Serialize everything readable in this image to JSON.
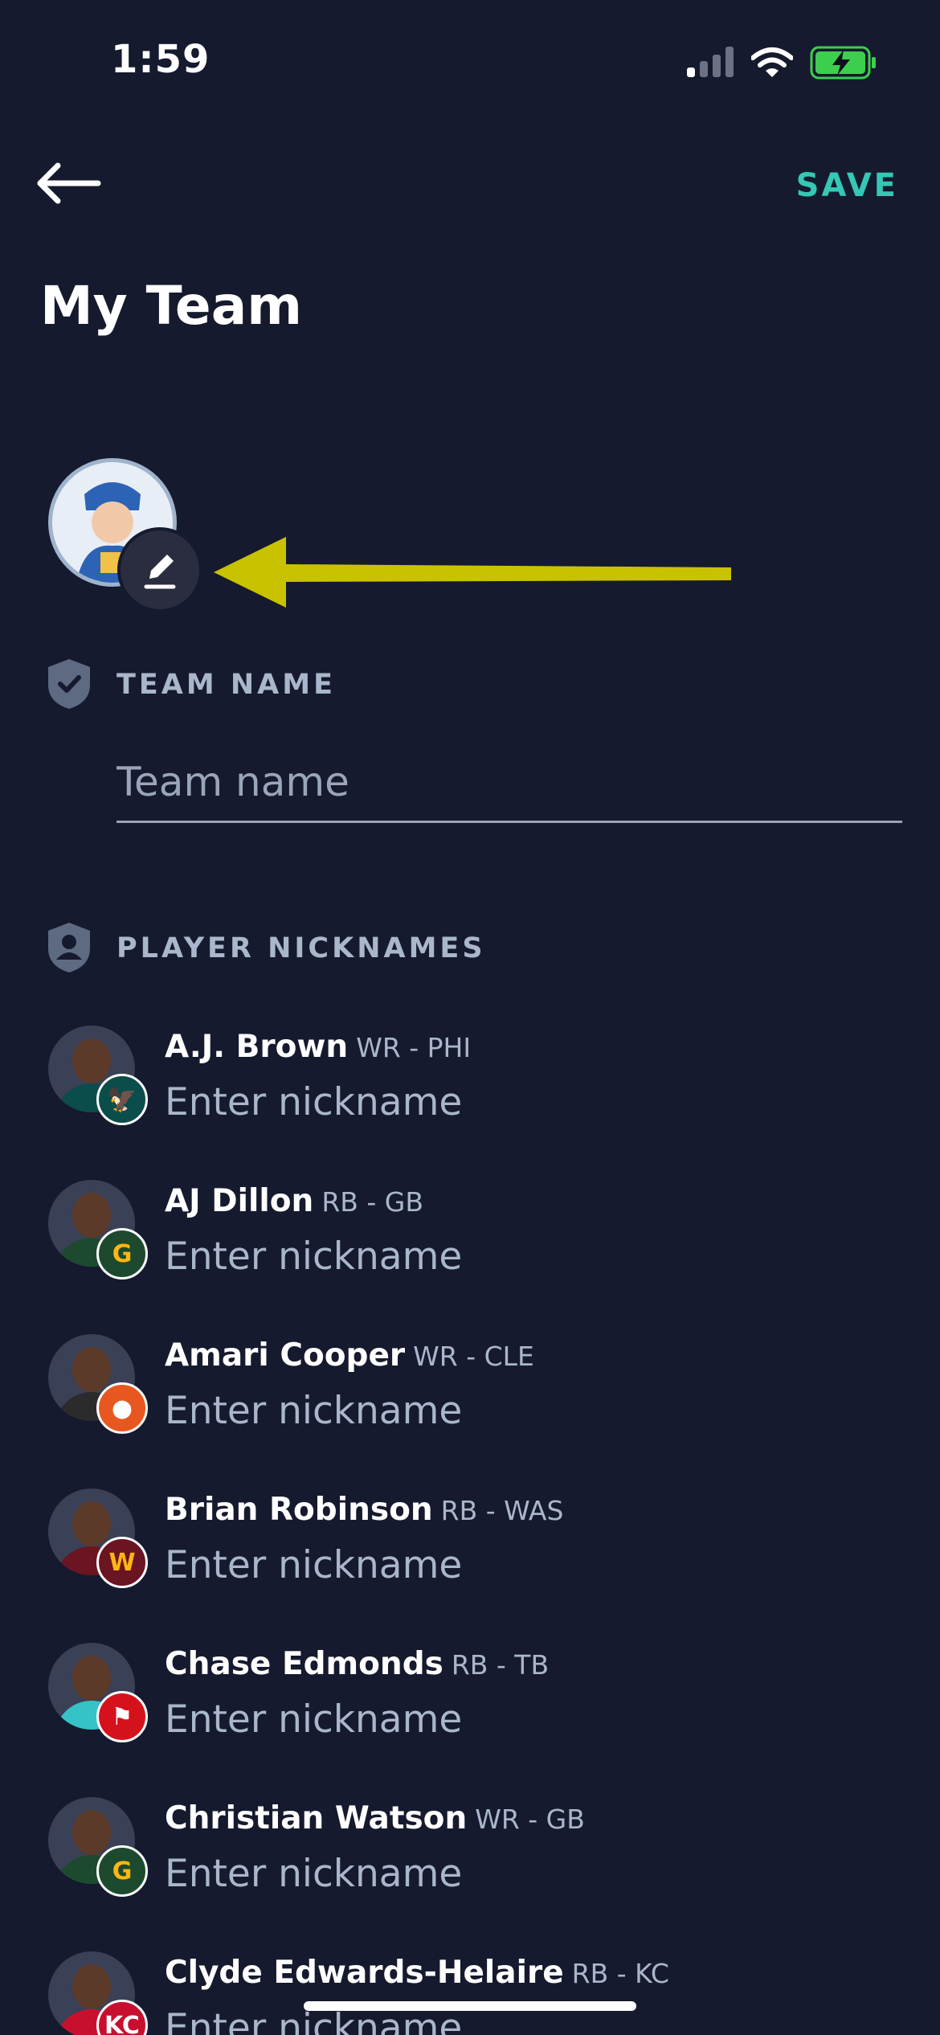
{
  "status_bar": {
    "time": "1:59"
  },
  "header": {
    "save_label": "SAVE",
    "title": "My Team"
  },
  "team_name_section": {
    "label": "TEAM NAME",
    "placeholder": "Team name",
    "value": ""
  },
  "nicknames_section": {
    "label": "PLAYER NICKNAMES"
  },
  "players": [
    {
      "name": "A.J. Brown",
      "position": "WR - PHI",
      "placeholder": "Enter nickname",
      "jersey_color": "#0b4d4a",
      "badge": "🦅",
      "badge_color": "#0b4d4a",
      "badge_text_color": "#ffffff"
    },
    {
      "name": "AJ Dillon",
      "position": "RB - GB",
      "placeholder": "Enter nickname",
      "jersey_color": "#1d4a2e",
      "badge": "G",
      "badge_color": "#1d4a2e",
      "badge_text_color": "#ffb612"
    },
    {
      "name": "Amari Cooper",
      "position": "WR - CLE",
      "placeholder": "Enter nickname",
      "jersey_color": "#2b2b2b",
      "badge": "●",
      "badge_color": "#e8571f",
      "badge_text_color": "#ffffff"
    },
    {
      "name": "Brian Robinson",
      "position": "RB - WAS",
      "placeholder": "Enter nickname",
      "jersey_color": "#6b1422",
      "badge": "W",
      "badge_color": "#6b1422",
      "badge_text_color": "#ffb612"
    },
    {
      "name": "Chase Edmonds",
      "position": "RB - TB",
      "placeholder": "Enter nickname",
      "jersey_color": "#35c3c7",
      "badge": "⚑",
      "badge_color": "#d5121c",
      "badge_text_color": "#ffffff"
    },
    {
      "name": "Christian Watson",
      "position": "WR - GB",
      "placeholder": "Enter nickname",
      "jersey_color": "#1d4a2e",
      "badge": "G",
      "badge_color": "#1d4a2e",
      "badge_text_color": "#ffb612"
    },
    {
      "name": "Clyde Edwards-Helaire",
      "position": "RB - KC",
      "placeholder": "Enter nickname",
      "jersey_color": "#c8102e",
      "badge": "KC",
      "badge_color": "#c8102e",
      "badge_text_color": "#ffffff"
    }
  ],
  "colors": {
    "background": "#161a2e",
    "accent": "#34c8b5",
    "muted_text": "#a9b6cc",
    "annotation_arrow": "#c9c200"
  },
  "icons": {
    "back": "arrow-left-icon",
    "edit": "pencil-icon",
    "team_section": "shield-check-icon",
    "nickname_section": "shield-person-icon"
  }
}
